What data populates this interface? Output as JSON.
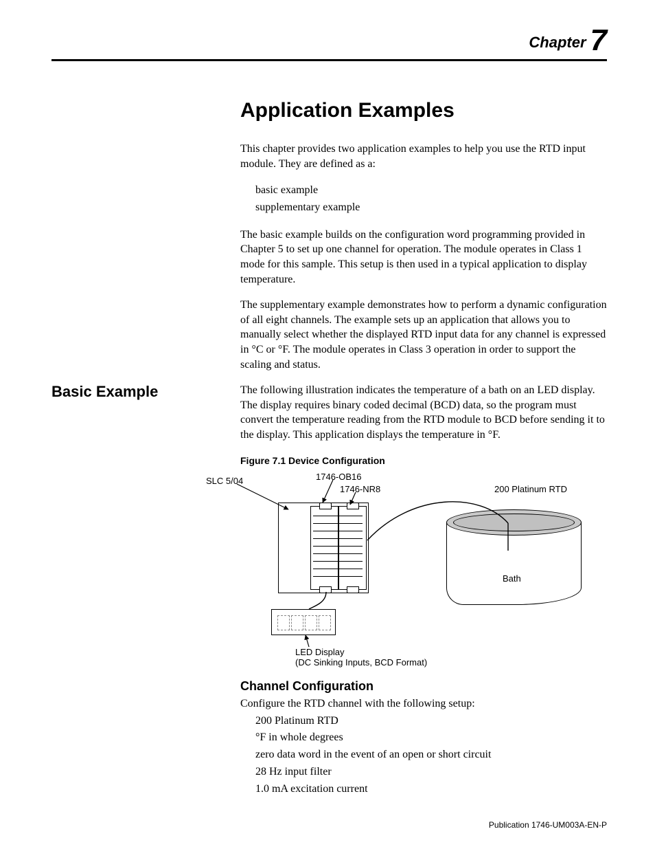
{
  "header": {
    "chapter_word": "Chapter",
    "chapter_number": "7"
  },
  "title": "Application Examples",
  "intro_p1": "This chapter provides two application examples to help you use the RTD input module. They are defined as a:",
  "intro_items": {
    "a": "basic example",
    "b": "supplementary example"
  },
  "intro_p2": "The basic example builds on the configuration word programming provided in Chapter 5 to set up one channel for operation. The module operates in Class 1 mode for this sample. This setup is then used in a typical application to display temperature.",
  "intro_p3": "The supplementary example demonstrates how to perform a dynamic configuration of all eight channels. The example sets up an application that allows you to manually select whether the displayed RTD input data for any channel is expressed in °C or °F. The module operates in Class 3 operation in order to support the scaling and status.",
  "basic": {
    "heading": "Basic Example",
    "p": "The following illustration indicates the temperature of a bath on an LED display. The display requires binary coded decimal (BCD) data, so the program must convert the temperature reading from the RTD module to BCD before sending it to the display. This application displays the temperature in °F."
  },
  "figure": {
    "title": "Figure 7.1 Device Configuration",
    "labels": {
      "slc": "SLC 5/04",
      "ob16": "1746-OB16",
      "nr8": "1746-NR8",
      "rtd": "200   Platinum RTD",
      "bath": "Bath",
      "led_l1": "LED Display",
      "led_l2": "(DC Sinking Inputs, BCD Format)"
    }
  },
  "channel": {
    "heading": "Channel Configuration",
    "lead": "Configure the RTD channel with the following setup:",
    "items": {
      "a": "200   Platinum RTD",
      "b": "°F in whole degrees",
      "c": "zero data word in the event of an open or short circuit",
      "d": "28 Hz input filter",
      "e": "1.0 mA excitation current"
    }
  },
  "publication": "Publication 1746-UM003A-EN-P"
}
